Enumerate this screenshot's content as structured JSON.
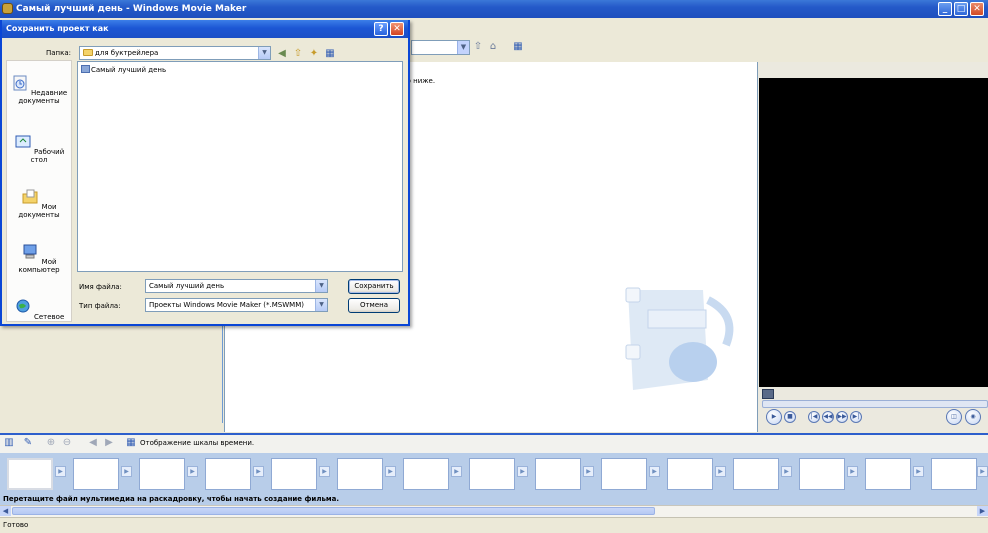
{
  "window": {
    "title": "Самый лучший день - Windows Movie Maker"
  },
  "main": {
    "content_text": "ю ниже."
  },
  "dialog": {
    "title": "Сохранить проект как",
    "folder_label": "Папка:",
    "folder_value": "для буктрейлера",
    "places": [
      {
        "label": "Недавние документы",
        "icon": "recent-documents-icon"
      },
      {
        "label": "Рабочий стол",
        "icon": "desktop-icon"
      },
      {
        "label": "Мои документы",
        "icon": "my-documents-icon"
      },
      {
        "label": "Мой компьютер",
        "icon": "my-computer-icon"
      },
      {
        "label": "Сетевое",
        "icon": "network-icon"
      }
    ],
    "files": [
      {
        "name": "Самый лучший день"
      }
    ],
    "filename_label": "Имя файла:",
    "filename_value": "Самый лучший день",
    "filetype_label": "Тип файла:",
    "filetype_value": "Проекты Windows Movie Maker (*.MSWMM)",
    "save_label": "Сохранить",
    "cancel_label": "Отмена"
  },
  "storyboard": {
    "timeline_toggle_label": "Отображение шкалы времени.",
    "hint": "Перетащите файл мультимедиа на раскадровку, чтобы начать создание фильма."
  },
  "status": {
    "text": "Готово"
  }
}
